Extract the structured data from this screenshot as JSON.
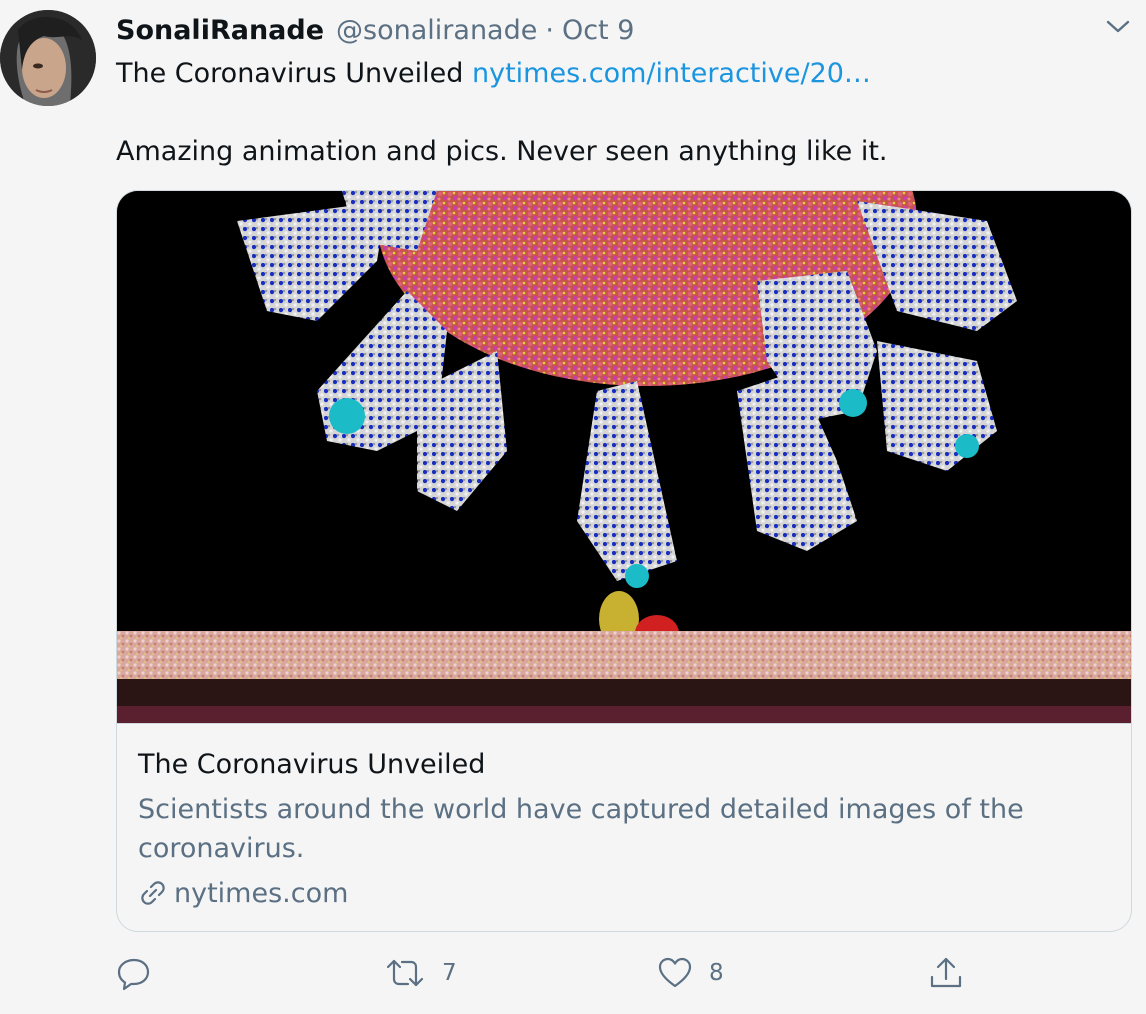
{
  "tweet": {
    "display_name": "SonaliRanade",
    "handle": "@sonaliranade",
    "separator": "·",
    "date": "Oct 9",
    "text_prefix": "The Coronavirus Unveiled ",
    "link_text": "nytimes.com/interactive/20…",
    "text_line2": "Amazing animation and pics.  Never seen anything like it."
  },
  "card": {
    "title": "The Coronavirus Unveiled",
    "description": "Scientists around the world have captured detailed images of the coronavirus.",
    "domain": "nytimes.com"
  },
  "actions": {
    "reply_icon": "reply-icon",
    "retweet_icon": "retweet-icon",
    "retweet_count": "7",
    "like_icon": "heart-icon",
    "like_count": "8",
    "share_icon": "share-icon"
  },
  "colors": {
    "background": "#f5f5f5",
    "text_primary": "#0f1419",
    "text_secondary": "#5b7083",
    "link": "#1b95e0",
    "border": "#cfd9de"
  }
}
